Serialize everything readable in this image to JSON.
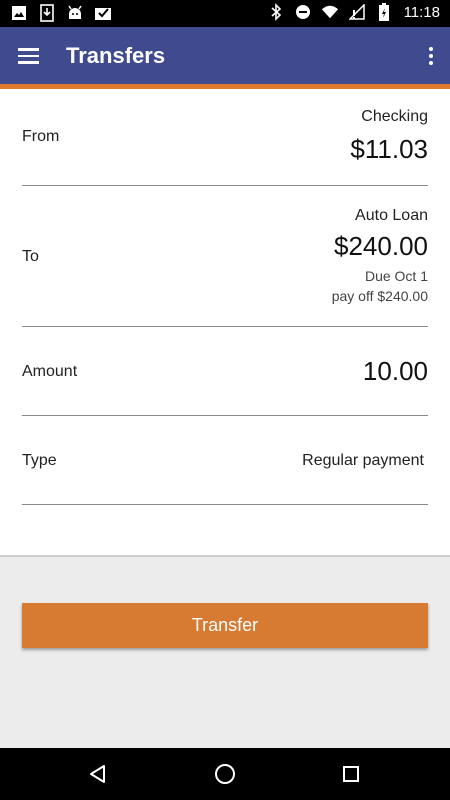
{
  "status_bar": {
    "time": "11:18",
    "left_icons": [
      "image-icon",
      "download-icon",
      "android-icon",
      "inbox-check-icon"
    ],
    "right_icons": [
      "bluetooth-icon",
      "do-not-disturb-icon",
      "wifi-icon",
      "signal-icon",
      "battery-charging-icon"
    ]
  },
  "app_bar": {
    "title": "Transfers",
    "color": "#3f4b8e",
    "accent": "#e07b2e"
  },
  "form": {
    "from": {
      "label": "From",
      "account": "Checking",
      "balance": "$11.03"
    },
    "to": {
      "label": "To",
      "account": "Auto Loan",
      "balance": "$240.00",
      "due": "Due Oct 1",
      "payoff": "pay off $240.00"
    },
    "amount": {
      "label": "Amount",
      "value": "10.00"
    },
    "type": {
      "label": "Type",
      "value": "Regular payment"
    }
  },
  "transfer_button": {
    "label": "Transfer",
    "color": "#d67b31"
  },
  "nav_bar": {
    "buttons": [
      "back-icon",
      "home-icon",
      "recents-icon"
    ]
  }
}
